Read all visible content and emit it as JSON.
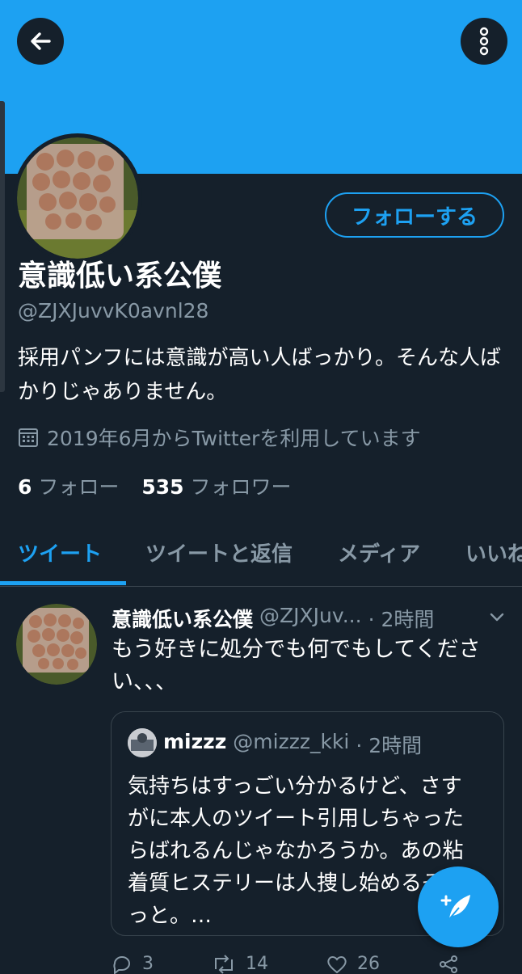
{
  "profile": {
    "name": "意識低い系公僕",
    "handle": "@ZJXJuvvK0avnl28",
    "bio": "採用パンフには意識が高い人ばっかり。そんな人ばかりじゃありません。",
    "joined": "2019年6月からTwitterを利用しています",
    "following_count": "6",
    "following_label": "フォロー",
    "followers_count": "535",
    "followers_label": "フォロワー",
    "follow_button": "フォローする"
  },
  "tabs": [
    {
      "label": "ツイート",
      "active": true
    },
    {
      "label": "ツイートと返信",
      "active": false
    },
    {
      "label": "メディア",
      "active": false
    },
    {
      "label": "いいね",
      "active": false
    }
  ],
  "tweet": {
    "name": "意識低い系公僕",
    "handle": "@ZJXJuv...",
    "time": "· 2時間",
    "text": "もう好きに処分でも何でもしてください、、、",
    "quote": {
      "name": "mizzz",
      "handle": "@mizzz_kki",
      "time": "· 2時間",
      "text": "気持ちはすっごい分かるけど、さすがに本人のツイート引用しちゃったらばれるんじゃなかろうか。あの粘着質ヒステリーは人捜し始めるぞきっと。…"
    },
    "replies": "3",
    "retweets": "14",
    "likes": "26"
  },
  "icons": {
    "back": "arrow-left-icon",
    "more": "more-vertical-icon",
    "calendar": "calendar-icon",
    "caret": "chevron-down-icon",
    "compose": "compose-tweet-icon",
    "reply": "reply-icon",
    "retweet": "retweet-icon",
    "like": "heart-icon",
    "share": "share-icon"
  },
  "colors": {
    "background": "#15202b",
    "banner": "#1da1f2",
    "accent": "#1da1f2",
    "secondary_text": "#8899a6",
    "border": "#38444d"
  }
}
